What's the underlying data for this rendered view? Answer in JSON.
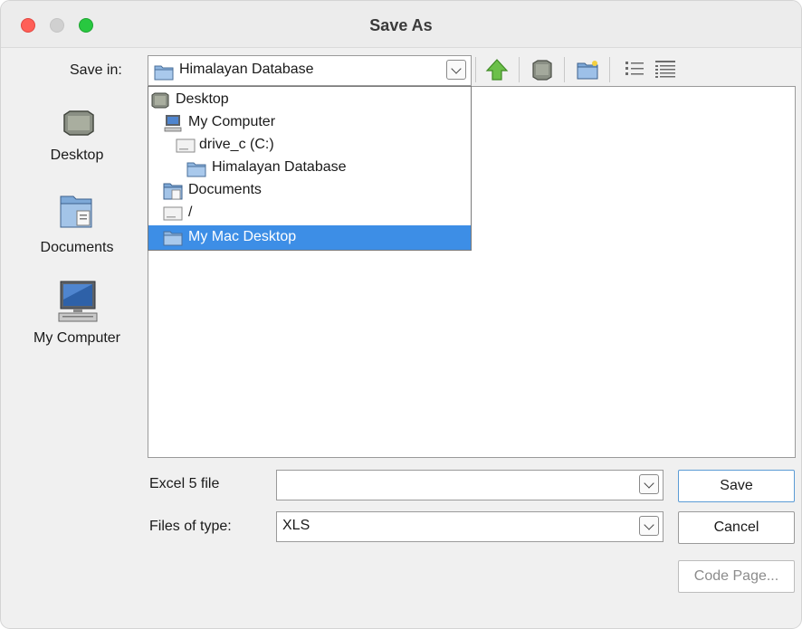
{
  "window": {
    "title": "Save As"
  },
  "save_in": {
    "label": "Save in:",
    "value": "Himalayan Database"
  },
  "toolbar": {
    "up_icon": "up-folder-icon",
    "desktop_icon": "desktop-icon",
    "new_folder_icon": "new-folder-icon",
    "list_view_icon": "list-view-icon",
    "details_view_icon": "details-view-icon"
  },
  "places": [
    {
      "label": "Desktop",
      "icon": "desktop-icon"
    },
    {
      "label": "Documents",
      "icon": "documents-icon"
    },
    {
      "label": "My Computer",
      "icon": "computer-icon"
    }
  ],
  "dropdown": {
    "items": [
      {
        "label": "Desktop",
        "icon": "desktop-icon",
        "selected": false
      },
      {
        "label": "My Computer",
        "icon": "computer-icon",
        "selected": false
      },
      {
        "label": "drive_c (C:)",
        "icon": "drive-icon",
        "selected": false
      },
      {
        "label": "Himalayan Database",
        "icon": "folder-icon",
        "selected": false
      },
      {
        "label": "Documents",
        "icon": "documents-icon",
        "selected": false
      },
      {
        "label": "/",
        "icon": "drive-icon",
        "selected": false
      },
      {
        "label": "My Mac Desktop",
        "icon": "folder-icon",
        "selected": true
      }
    ],
    "selected_color": "#3d8ee6"
  },
  "file_name": {
    "label": "Excel 5 file",
    "value": ""
  },
  "file_type": {
    "label": "Files of type:",
    "value": "XLS"
  },
  "buttons": {
    "save": "Save",
    "cancel": "Cancel",
    "code_page": "Code Page..."
  },
  "colors": {
    "close": "#ff5f57",
    "minimize": "#d0d0d0",
    "maximize": "#28c840",
    "accent": "#3d8ee6"
  }
}
